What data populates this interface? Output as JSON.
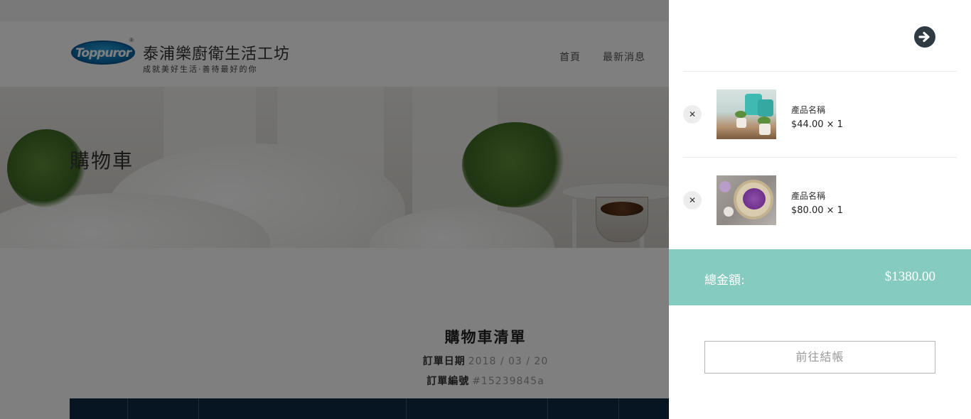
{
  "brand": {
    "logo_text": "Toppuror",
    "registered_mark": "®",
    "name": "泰浦樂廚衛生活工坊",
    "slogan": "成就美好生活‧善待最好的你"
  },
  "nav": {
    "items": [
      {
        "label": "首頁"
      },
      {
        "label": "最新消息"
      }
    ]
  },
  "page": {
    "title": "購物車",
    "cart_list_title": "購物車清單",
    "order_date_label": "訂單日期",
    "order_date_value": "2018 / 03 / 20",
    "order_no_label": "訂單編號",
    "order_no_value": "#15239845a"
  },
  "cart_drawer": {
    "close_icon": "arrow-circle-right-icon",
    "remove_icon": "close-icon",
    "items": [
      {
        "name": "產品名稱",
        "price_qty": "$44.00 × 1"
      },
      {
        "name": "產品名稱",
        "price_qty": "$80.00 × 1"
      }
    ],
    "total_label": "總金額:",
    "total_value": "$1380.00",
    "checkout_label": "前往結帳"
  },
  "colors": {
    "total_bar": "#85cbbf",
    "table_header": "#0e2a44",
    "overlay": "rgba(0,0,0,0.5)"
  }
}
